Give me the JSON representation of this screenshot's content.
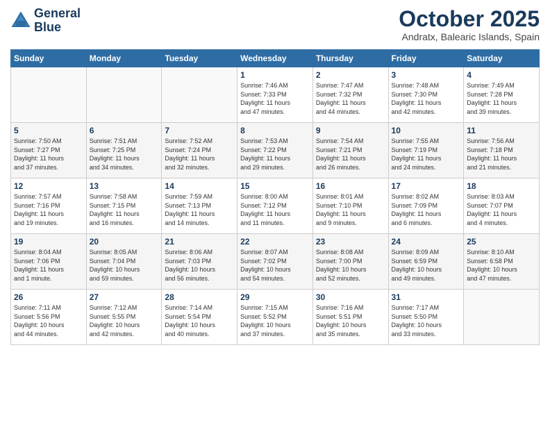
{
  "logo": {
    "line1": "General",
    "line2": "Blue"
  },
  "title": "October 2025",
  "subtitle": "Andratx, Balearic Islands, Spain",
  "days_of_week": [
    "Sunday",
    "Monday",
    "Tuesday",
    "Wednesday",
    "Thursday",
    "Friday",
    "Saturday"
  ],
  "weeks": [
    [
      {
        "num": "",
        "info": ""
      },
      {
        "num": "",
        "info": ""
      },
      {
        "num": "",
        "info": ""
      },
      {
        "num": "1",
        "info": "Sunrise: 7:46 AM\nSunset: 7:33 PM\nDaylight: 11 hours\nand 47 minutes."
      },
      {
        "num": "2",
        "info": "Sunrise: 7:47 AM\nSunset: 7:32 PM\nDaylight: 11 hours\nand 44 minutes."
      },
      {
        "num": "3",
        "info": "Sunrise: 7:48 AM\nSunset: 7:30 PM\nDaylight: 11 hours\nand 42 minutes."
      },
      {
        "num": "4",
        "info": "Sunrise: 7:49 AM\nSunset: 7:28 PM\nDaylight: 11 hours\nand 39 minutes."
      }
    ],
    [
      {
        "num": "5",
        "info": "Sunrise: 7:50 AM\nSunset: 7:27 PM\nDaylight: 11 hours\nand 37 minutes."
      },
      {
        "num": "6",
        "info": "Sunrise: 7:51 AM\nSunset: 7:25 PM\nDaylight: 11 hours\nand 34 minutes."
      },
      {
        "num": "7",
        "info": "Sunrise: 7:52 AM\nSunset: 7:24 PM\nDaylight: 11 hours\nand 32 minutes."
      },
      {
        "num": "8",
        "info": "Sunrise: 7:53 AM\nSunset: 7:22 PM\nDaylight: 11 hours\nand 29 minutes."
      },
      {
        "num": "9",
        "info": "Sunrise: 7:54 AM\nSunset: 7:21 PM\nDaylight: 11 hours\nand 26 minutes."
      },
      {
        "num": "10",
        "info": "Sunrise: 7:55 AM\nSunset: 7:19 PM\nDaylight: 11 hours\nand 24 minutes."
      },
      {
        "num": "11",
        "info": "Sunrise: 7:56 AM\nSunset: 7:18 PM\nDaylight: 11 hours\nand 21 minutes."
      }
    ],
    [
      {
        "num": "12",
        "info": "Sunrise: 7:57 AM\nSunset: 7:16 PM\nDaylight: 11 hours\nand 19 minutes."
      },
      {
        "num": "13",
        "info": "Sunrise: 7:58 AM\nSunset: 7:15 PM\nDaylight: 11 hours\nand 16 minutes."
      },
      {
        "num": "14",
        "info": "Sunrise: 7:59 AM\nSunset: 7:13 PM\nDaylight: 11 hours\nand 14 minutes."
      },
      {
        "num": "15",
        "info": "Sunrise: 8:00 AM\nSunset: 7:12 PM\nDaylight: 11 hours\nand 11 minutes."
      },
      {
        "num": "16",
        "info": "Sunrise: 8:01 AM\nSunset: 7:10 PM\nDaylight: 11 hours\nand 9 minutes."
      },
      {
        "num": "17",
        "info": "Sunrise: 8:02 AM\nSunset: 7:09 PM\nDaylight: 11 hours\nand 6 minutes."
      },
      {
        "num": "18",
        "info": "Sunrise: 8:03 AM\nSunset: 7:07 PM\nDaylight: 11 hours\nand 4 minutes."
      }
    ],
    [
      {
        "num": "19",
        "info": "Sunrise: 8:04 AM\nSunset: 7:06 PM\nDaylight: 11 hours\nand 1 minute."
      },
      {
        "num": "20",
        "info": "Sunrise: 8:05 AM\nSunset: 7:04 PM\nDaylight: 10 hours\nand 59 minutes."
      },
      {
        "num": "21",
        "info": "Sunrise: 8:06 AM\nSunset: 7:03 PM\nDaylight: 10 hours\nand 56 minutes."
      },
      {
        "num": "22",
        "info": "Sunrise: 8:07 AM\nSunset: 7:02 PM\nDaylight: 10 hours\nand 54 minutes."
      },
      {
        "num": "23",
        "info": "Sunrise: 8:08 AM\nSunset: 7:00 PM\nDaylight: 10 hours\nand 52 minutes."
      },
      {
        "num": "24",
        "info": "Sunrise: 8:09 AM\nSunset: 6:59 PM\nDaylight: 10 hours\nand 49 minutes."
      },
      {
        "num": "25",
        "info": "Sunrise: 8:10 AM\nSunset: 6:58 PM\nDaylight: 10 hours\nand 47 minutes."
      }
    ],
    [
      {
        "num": "26",
        "info": "Sunrise: 7:11 AM\nSunset: 5:56 PM\nDaylight: 10 hours\nand 44 minutes."
      },
      {
        "num": "27",
        "info": "Sunrise: 7:12 AM\nSunset: 5:55 PM\nDaylight: 10 hours\nand 42 minutes."
      },
      {
        "num": "28",
        "info": "Sunrise: 7:14 AM\nSunset: 5:54 PM\nDaylight: 10 hours\nand 40 minutes."
      },
      {
        "num": "29",
        "info": "Sunrise: 7:15 AM\nSunset: 5:52 PM\nDaylight: 10 hours\nand 37 minutes."
      },
      {
        "num": "30",
        "info": "Sunrise: 7:16 AM\nSunset: 5:51 PM\nDaylight: 10 hours\nand 35 minutes."
      },
      {
        "num": "31",
        "info": "Sunrise: 7:17 AM\nSunset: 5:50 PM\nDaylight: 10 hours\nand 33 minutes."
      },
      {
        "num": "",
        "info": ""
      }
    ]
  ]
}
